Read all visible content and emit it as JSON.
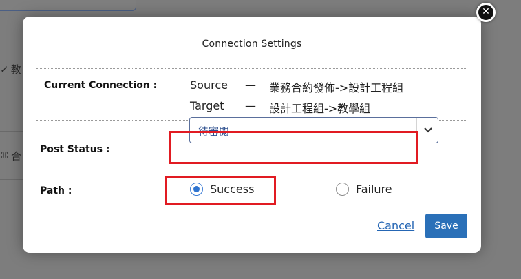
{
  "background": {
    "item1": "教",
    "item2": "合"
  },
  "modal": {
    "title": "Connection Settings",
    "current_connection_label": "Current Connection :",
    "source_key": "Source",
    "source_dash": "—",
    "source_value": "業務合約發佈->設計工程組",
    "target_key": "Target",
    "target_dash": "—",
    "target_value": "設計工程組->教學組",
    "post_status_label": "Post Status :",
    "post_status_value": "待審閱",
    "path_label": "Path :",
    "path_options": [
      "Success",
      "Failure"
    ],
    "path_selected": "Success",
    "cancel_label": "Cancel",
    "save_label": "Save",
    "close_glyph": "✕"
  },
  "colors": {
    "highlight": "#e11b22",
    "primary": "#2a70b8",
    "link": "#2566b4"
  }
}
